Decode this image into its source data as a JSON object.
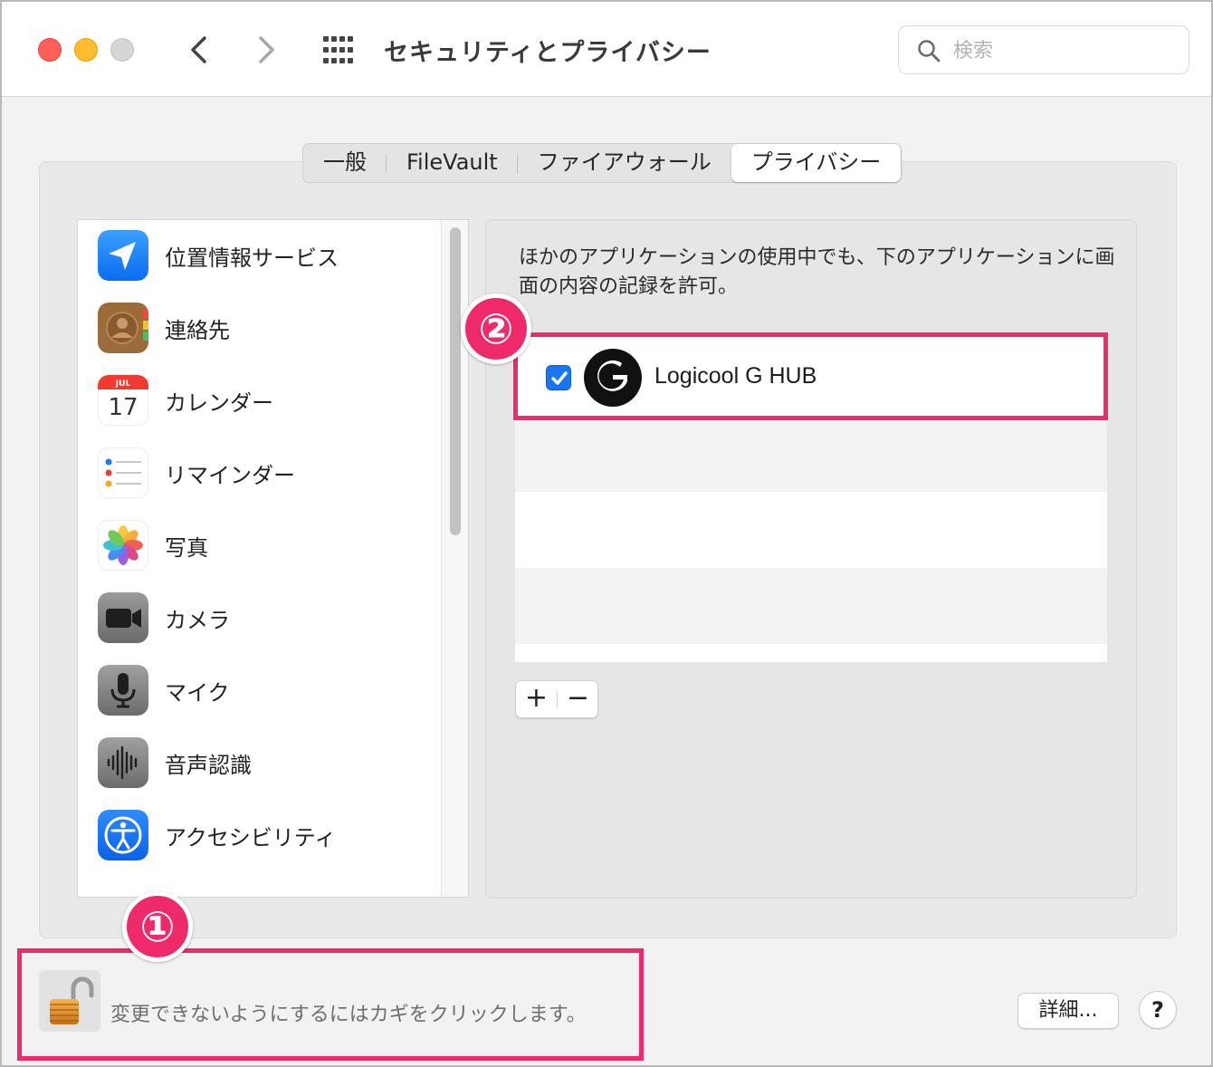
{
  "window": {
    "title": "セキュリティとプライバシー"
  },
  "search": {
    "placeholder": "検索",
    "value": ""
  },
  "tabs": [
    {
      "label": "一般",
      "active": false
    },
    {
      "label": "FileVault",
      "active": false
    },
    {
      "label": "ファイアウォール",
      "active": false
    },
    {
      "label": "プライバシー",
      "active": true
    }
  ],
  "sidebar": {
    "items": [
      {
        "label": "位置情報サービス",
        "icon": "location-arrow-icon"
      },
      {
        "label": "連絡先",
        "icon": "contacts-icon"
      },
      {
        "label": "カレンダー",
        "icon": "calendar-icon",
        "calendar_month": "JUL",
        "calendar_day": "17"
      },
      {
        "label": "リマインダー",
        "icon": "reminders-icon"
      },
      {
        "label": "写真",
        "icon": "photos-icon"
      },
      {
        "label": "カメラ",
        "icon": "camera-icon"
      },
      {
        "label": "マイク",
        "icon": "microphone-icon"
      },
      {
        "label": "音声認識",
        "icon": "speech-recognition-icon"
      },
      {
        "label": "アクセシビリティ",
        "icon": "accessibility-icon"
      }
    ]
  },
  "content": {
    "description": "ほかのアプリケーションの使用中でも、下のアプリケーションに画面の内容の記録を許可。",
    "apps": [
      {
        "name": "Logicool G HUB",
        "checked": true,
        "icon": "logitech-g-icon"
      }
    ],
    "add_label": "+",
    "remove_label": "−"
  },
  "footer": {
    "lock_text": "変更できないようにするにはカギをクリックします。",
    "details_label": "詳細...",
    "help_label": "?"
  },
  "annotations": {
    "badge1": "①",
    "badge2": "②"
  },
  "colors": {
    "highlight": "#ee2a6b",
    "checkbox": "#1976f3"
  }
}
